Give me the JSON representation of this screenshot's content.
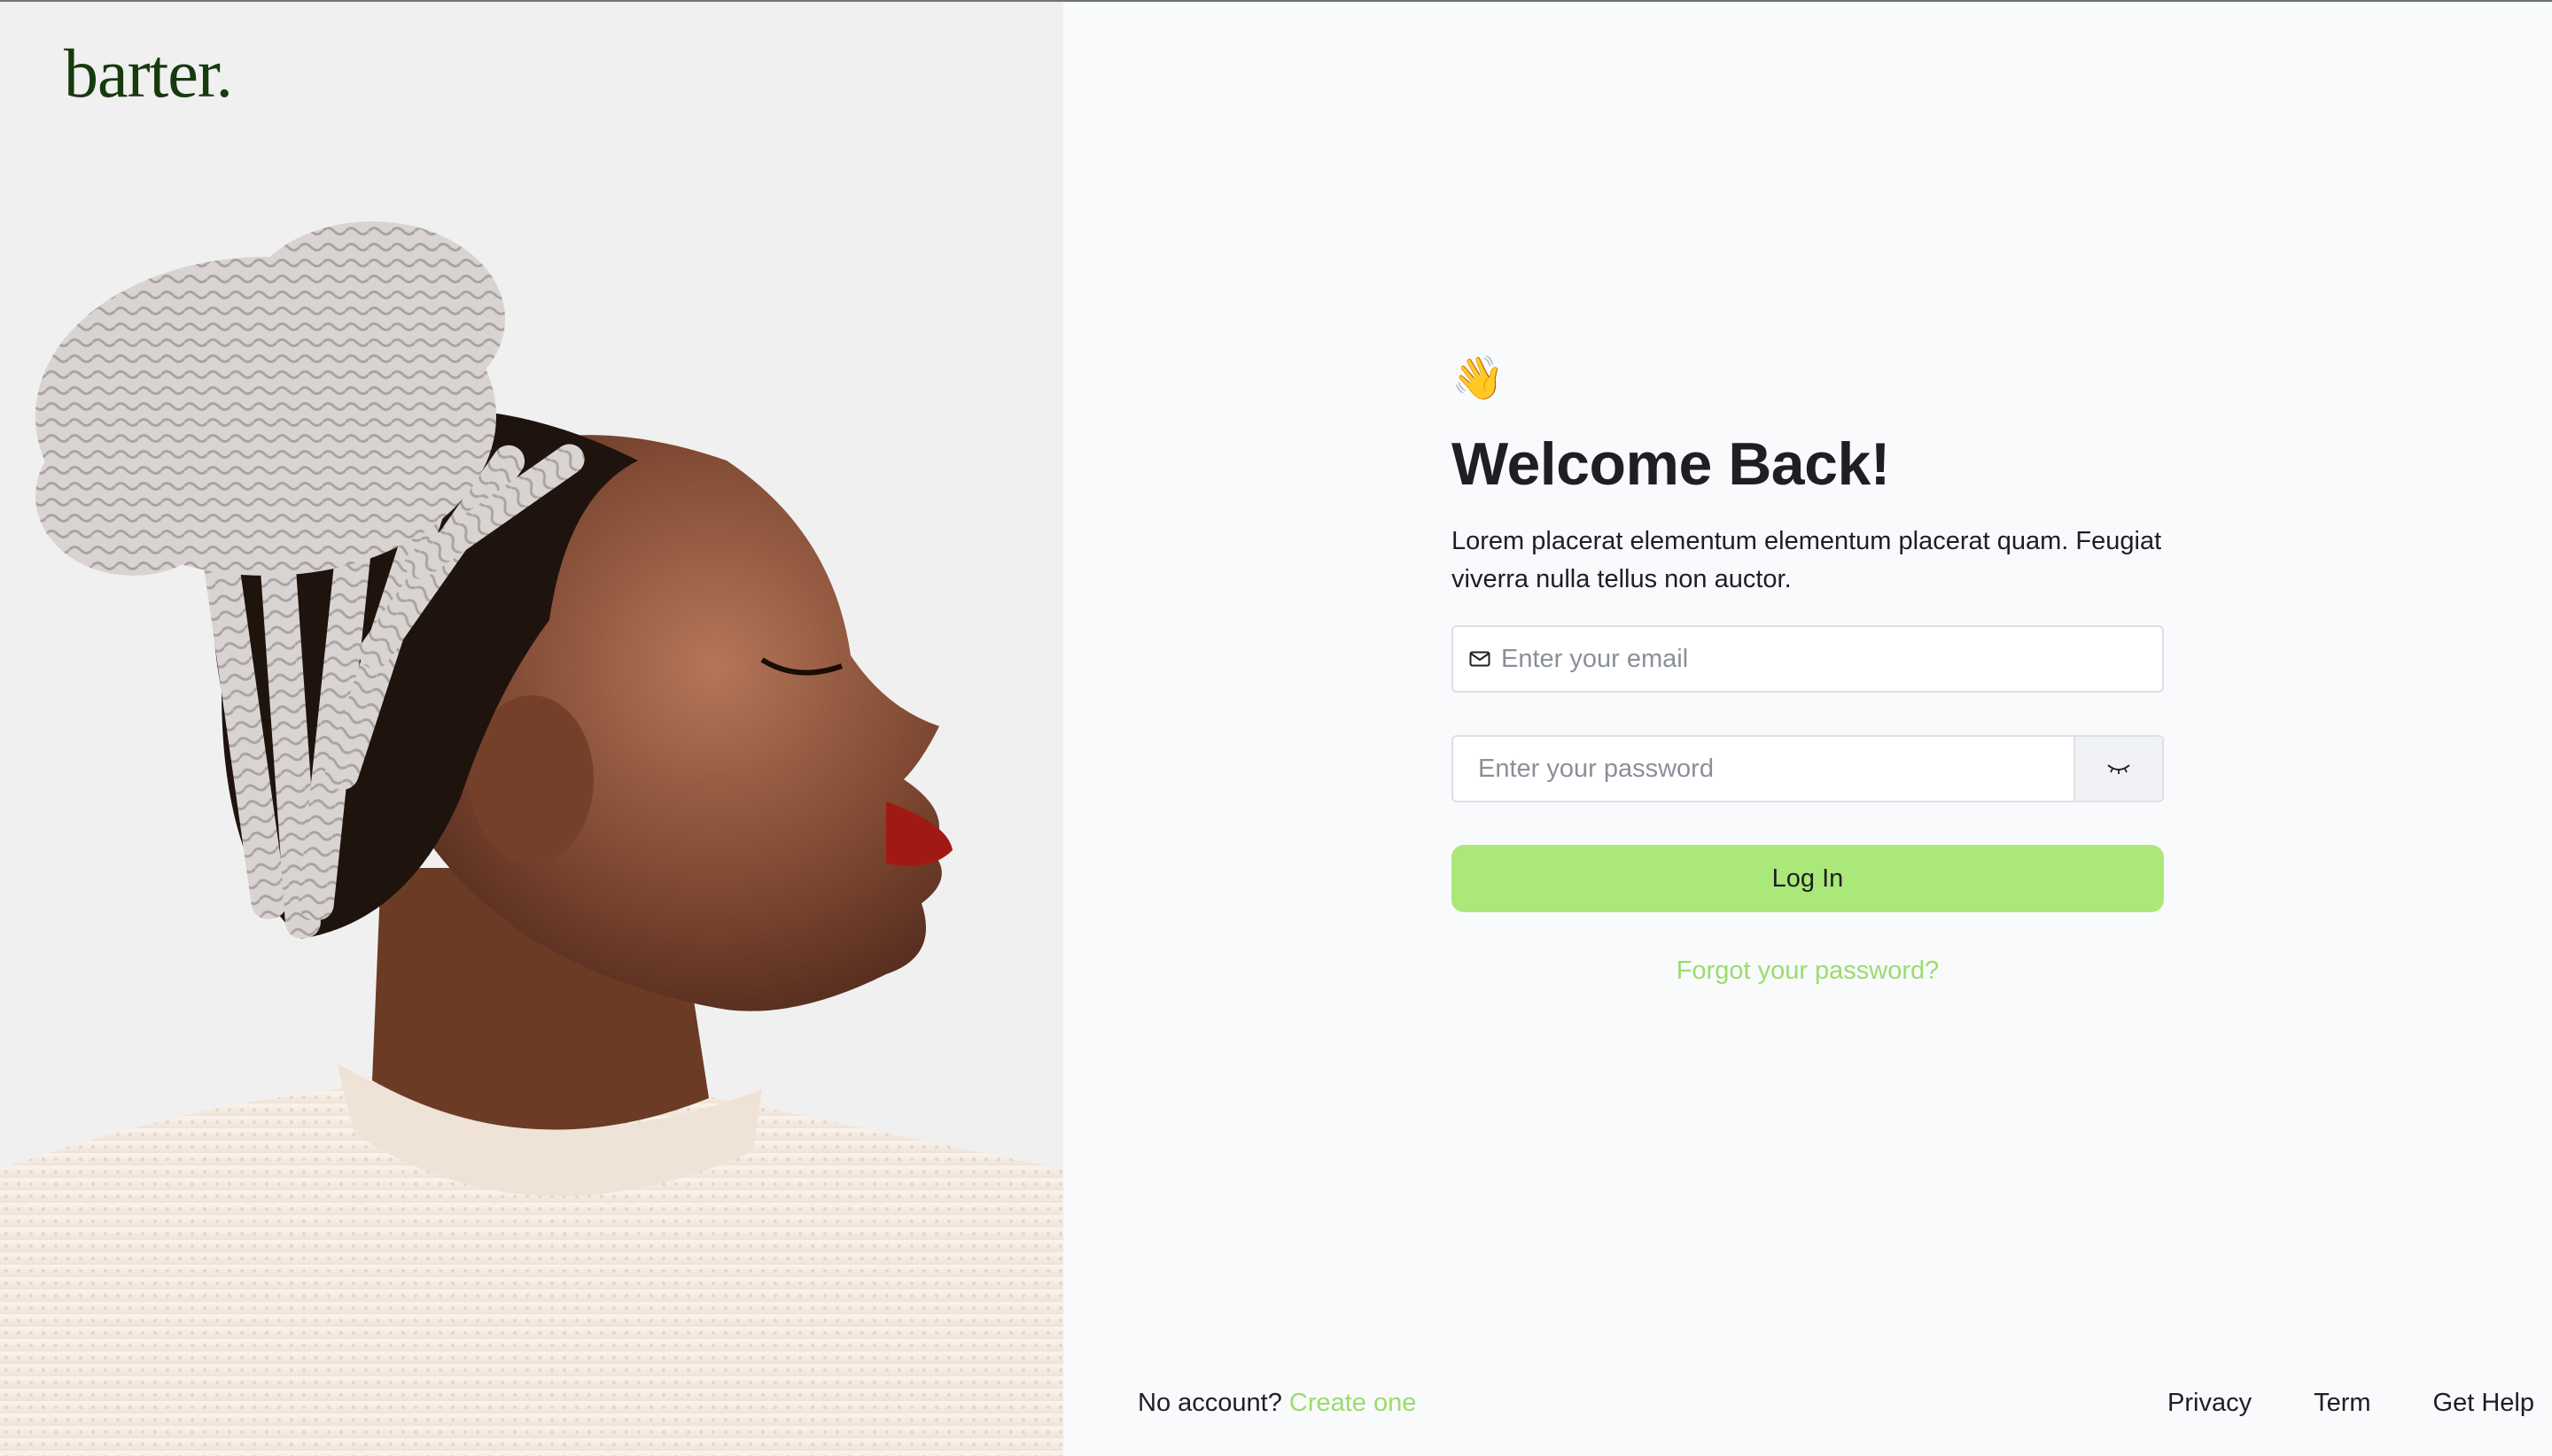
{
  "brand": {
    "logo_text": "barter."
  },
  "hero": {
    "image": "woman-profile-portrait"
  },
  "form": {
    "emoji": "👋",
    "title": "Welcome Back!",
    "subtitle": "Lorem placerat elementum elementum placerat quam. Feugiat viverra nulla tellus non auctor.",
    "email_placeholder": "Enter your email",
    "email_value": "",
    "password_placeholder": "Enter your password",
    "password_value": "",
    "login_label": "Log In",
    "forgot_label": "Forgot your password?"
  },
  "footer": {
    "no_account_text": "No account?",
    "create_label": "Create one",
    "links": [
      "Privacy",
      "Term",
      "Get Help"
    ]
  },
  "colors": {
    "accent": "#aae87a",
    "link": "#9bdc6b",
    "logo": "#173a0e",
    "text": "#1d1f24"
  }
}
